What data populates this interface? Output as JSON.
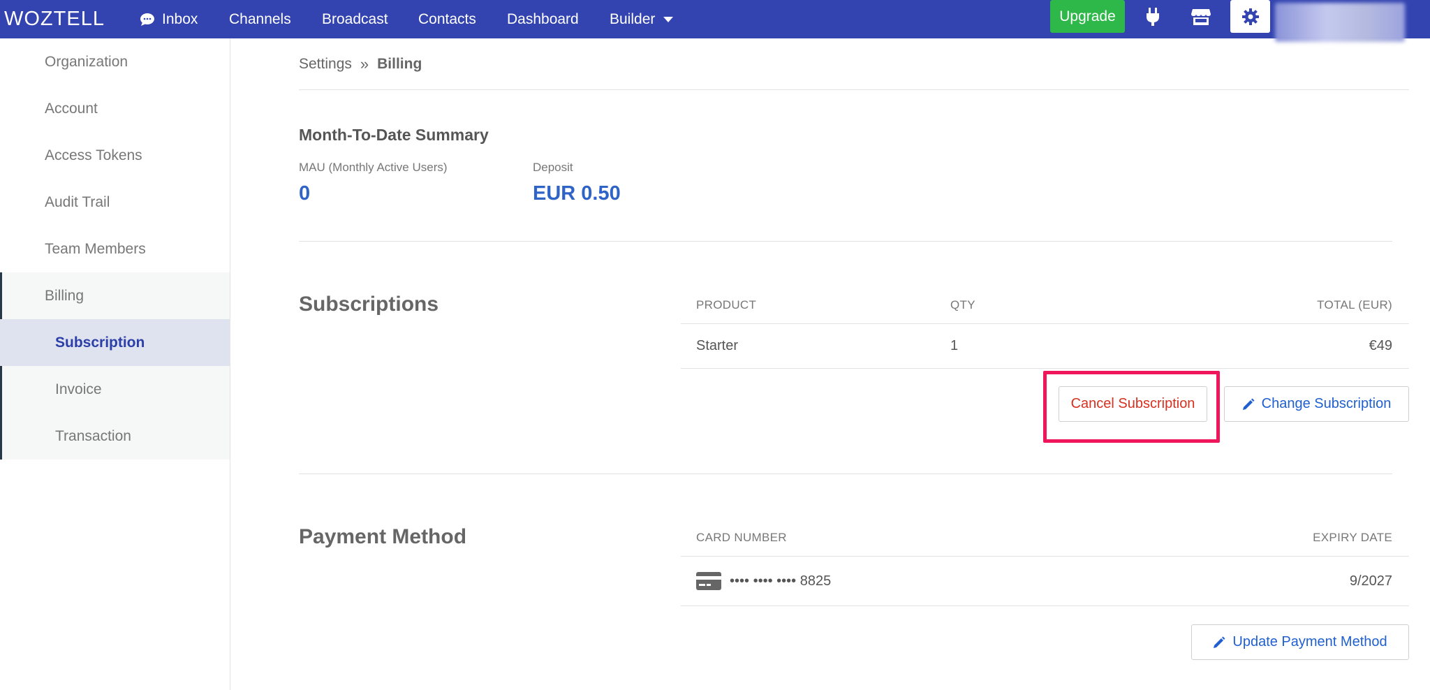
{
  "nav": {
    "logo": "WOZTELL",
    "items": [
      "Inbox",
      "Channels",
      "Broadcast",
      "Contacts",
      "Dashboard",
      "Builder"
    ],
    "upgrade_label": "Upgrade"
  },
  "sidebar": {
    "items": [
      "Organization",
      "Account",
      "Access Tokens",
      "Audit Trail",
      "Team Members"
    ],
    "billing": {
      "label": "Billing",
      "children": [
        "Subscription",
        "Invoice",
        "Transaction"
      ]
    }
  },
  "breadcrumb": {
    "parent": "Settings",
    "current": "Billing"
  },
  "summary": {
    "title": "Month-To-Date Summary",
    "mau_label": "MAU (Monthly Active Users)",
    "mau_value": "0",
    "deposit_label": "Deposit",
    "deposit_value": "EUR 0.50"
  },
  "subscriptions": {
    "title": "Subscriptions",
    "headers": {
      "product": "PRODUCT",
      "qty": "QTY",
      "total": "TOTAL (EUR)"
    },
    "rows": [
      {
        "product": "Starter",
        "qty": "1",
        "total": "€49"
      }
    ],
    "cancel_label": "Cancel Subscription",
    "change_label": "Change Subscription"
  },
  "payment": {
    "title": "Payment Method",
    "headers": {
      "card": "CARD NUMBER",
      "expiry": "EXPIRY DATE"
    },
    "card_number": "•••• •••• •••• 8825",
    "expiry": "9/2027",
    "update_label": "Update Payment Method"
  },
  "colors": {
    "topbar": "#3344b0",
    "upgrade": "#2fb84a",
    "link_blue": "#2f63c8",
    "cancel_red": "#d6301f",
    "highlight": "#f0165b"
  }
}
